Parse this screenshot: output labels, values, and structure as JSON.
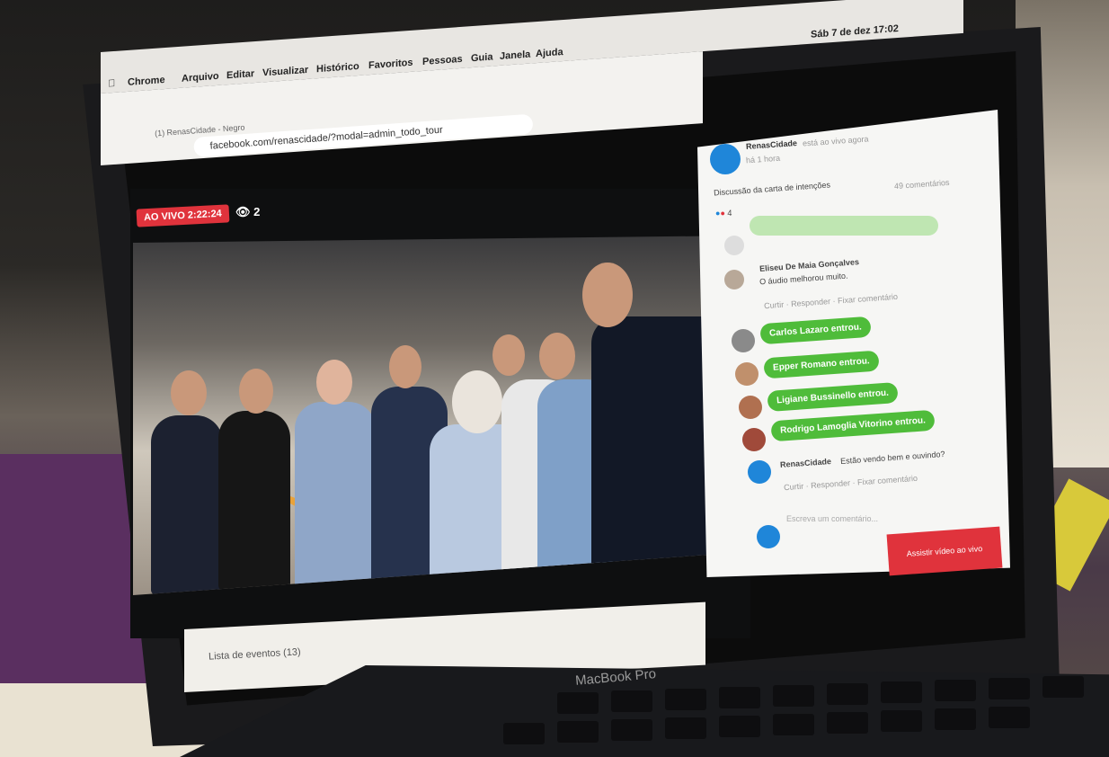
{
  "menubar": {
    "app": "Chrome",
    "items": [
      "Arquivo",
      "Editar",
      "Visualizar",
      "Histórico",
      "Favoritos",
      "Pessoas",
      "Guia",
      "Janela",
      "Ajuda"
    ],
    "clock": "Sáb 7 de dez 17:02"
  },
  "browser": {
    "tab_title": "(1) RenasCidade - Negro",
    "url": "facebook.com/renascidade/?modal=admin_todo_tour"
  },
  "video": {
    "live_label": "AO VIVO 2:22:24",
    "viewer_count": "2"
  },
  "panel": {
    "page_name": "RenasCidade",
    "status": "está ao vivo agora",
    "time": "há 1 hora",
    "description": "Discussão da carta de intenções",
    "comments_count": "49 comentários",
    "reactions_count": "4",
    "comment_author": "Eliseu De Maia Gonçalves",
    "comment_text": "O áudio melhorou muito.",
    "comment_actions": "Curtir · Responder · Fixar comentário",
    "joins": [
      "Carlos Lazaro entrou.",
      "Epper Romano entrou.",
      "Ligiane Bussinello entrou.",
      "Rodrigo Lamoglia Vitorino entrou."
    ],
    "owner_comment_author": "RenasCidade",
    "owner_comment_text": "Estão vendo bem e ouvindo?",
    "comment_placeholder": "Escreva um comentário...",
    "watch_button": "Assistir vídeo ao vivo"
  },
  "footer": {
    "text": "Lista de eventos (13)"
  },
  "laptop": {
    "brand": "MacBook Pro"
  }
}
